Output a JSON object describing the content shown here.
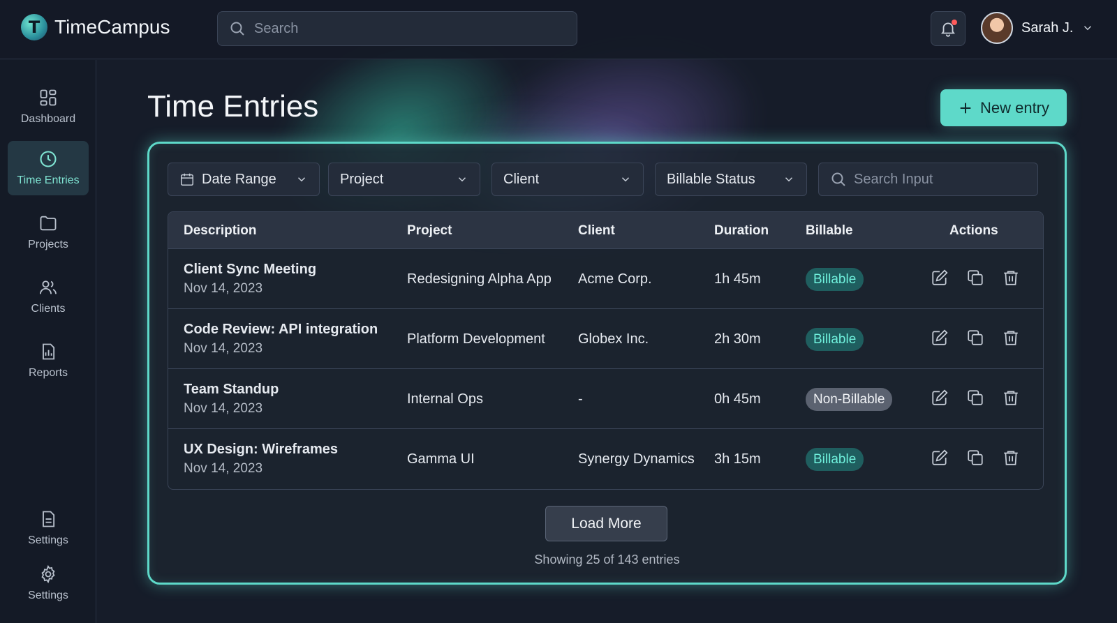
{
  "app": {
    "name": "TimeCampus"
  },
  "header": {
    "search_placeholder": "Search",
    "user_name": "Sarah J."
  },
  "sidebar": {
    "items": [
      {
        "label": "Dashboard"
      },
      {
        "label": "Time Entries"
      },
      {
        "label": "Projects"
      },
      {
        "label": "Clients"
      },
      {
        "label": "Reports"
      },
      {
        "label": "Settings"
      },
      {
        "label": "Settings"
      }
    ]
  },
  "main": {
    "title": "Time Entries",
    "new_entry_label": "New entry",
    "filters": {
      "date_range": "Date Range",
      "project": "Project",
      "client": "Client",
      "billable_status": "Billable Status",
      "search_placeholder": "Search Input"
    },
    "table": {
      "columns": [
        "Description",
        "Project",
        "Client",
        "Duration",
        "Billable",
        "Actions"
      ],
      "rows": [
        {
          "description": "Client Sync Meeting",
          "date": "Nov 14, 2023",
          "project": "Redesigning Alpha App",
          "client": "Acme Corp.",
          "duration": "1h 45m",
          "billable": "Billable"
        },
        {
          "description": "Code Review: API integration",
          "date": "Nov 14, 2023",
          "project": "Platform Development",
          "client": "Globex Inc.",
          "duration": "2h 30m",
          "billable": "Billable"
        },
        {
          "description": "Team Standup",
          "date": "Nov 14, 2023",
          "project": "Internal Ops",
          "client": "-",
          "duration": "0h 45m",
          "billable": "Non-Billable"
        },
        {
          "description": "UX Design: Wireframes",
          "date": "Nov 14, 2023",
          "project": "Gamma UI",
          "client": "Synergy Dynamics",
          "duration": "3h 15m",
          "billable": "Billable"
        }
      ]
    },
    "load_more_label": "Load More",
    "showing_text": "Showing 25 of 143 entries"
  },
  "colors": {
    "accent": "#5ed9c9",
    "background": "#161c29",
    "billable_badge": "#1f5e5f",
    "non_billable_badge": "#5b6270",
    "notification_dot": "#ff5b5b"
  }
}
